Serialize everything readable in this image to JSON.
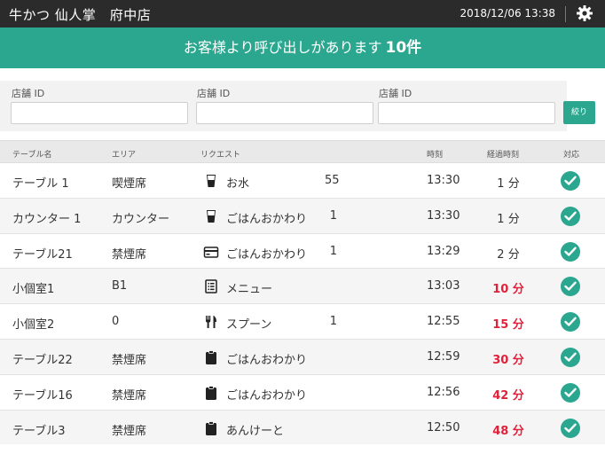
{
  "header": {
    "store_name": "牛かつ 仙人掌　府中店",
    "datetime": "2018/12/06  13:38",
    "settings_icon": "gear-icon"
  },
  "banner": {
    "message": "お客様より呼び出しがあります",
    "count": "10件"
  },
  "filters": {
    "fields": [
      {
        "label": "店舗 ID",
        "value": "",
        "placeholder": ""
      },
      {
        "label": "店舗 ID",
        "value": "",
        "placeholder": ""
      },
      {
        "label": "店舗 ID",
        "value": "",
        "placeholder": ""
      }
    ],
    "button_label": "絞り"
  },
  "table": {
    "headers": {
      "name": "テーブル名",
      "area": "エリア",
      "request": "リクエスト",
      "time": "時刻",
      "elapsed": "経過時刻",
      "action": "対応"
    },
    "rows": [
      {
        "name": "テーブル 1",
        "area": "喫煙席",
        "icon": "water-glass-icon",
        "request": "お水",
        "qty": "55",
        "time": "13:30",
        "elapsed": "1 分",
        "late": false
      },
      {
        "name": "カウンター 1",
        "area": "カウンター",
        "icon": "water-glass-icon",
        "request": "ごはんおかわり",
        "qty": "1",
        "time": "13:30",
        "elapsed": "1 分",
        "late": false
      },
      {
        "name": "テーブル21",
        "area": "禁煙席",
        "icon": "credit-card-icon",
        "request": "ごはんおかわり",
        "qty": "1",
        "time": "13:29",
        "elapsed": "2 分",
        "late": false
      },
      {
        "name": "小個室1",
        "area": "B1",
        "icon": "menu-list-icon",
        "request": "メニュー",
        "qty": "",
        "time": "13:03",
        "elapsed": "10 分",
        "late": true
      },
      {
        "name": "小個室2",
        "area": "0",
        "icon": "utensils-icon",
        "request": "スプーン",
        "qty": "1",
        "time": "12:55",
        "elapsed": "15 分",
        "late": true
      },
      {
        "name": "テーブル22",
        "area": "禁煙席",
        "icon": "clipboard-icon",
        "request": "ごはんおわかり",
        "qty": "",
        "time": "12:59",
        "elapsed": "30 分",
        "late": true
      },
      {
        "name": "テーブル16",
        "area": "禁煙席",
        "icon": "clipboard-icon",
        "request": "ごはんおわかり",
        "qty": "",
        "time": "12:56",
        "elapsed": "42 分",
        "late": true
      },
      {
        "name": "テーブル3",
        "area": "禁煙席",
        "icon": "clipboard-icon",
        "request": "あんけーと",
        "qty": "",
        "time": "12:50",
        "elapsed": "48 分",
        "late": true
      }
    ],
    "action_icon": "check-circle-icon"
  },
  "colors": {
    "accent": "#2ba78f",
    "header_bg": "#2b2b2b",
    "late": "#e0213b"
  }
}
